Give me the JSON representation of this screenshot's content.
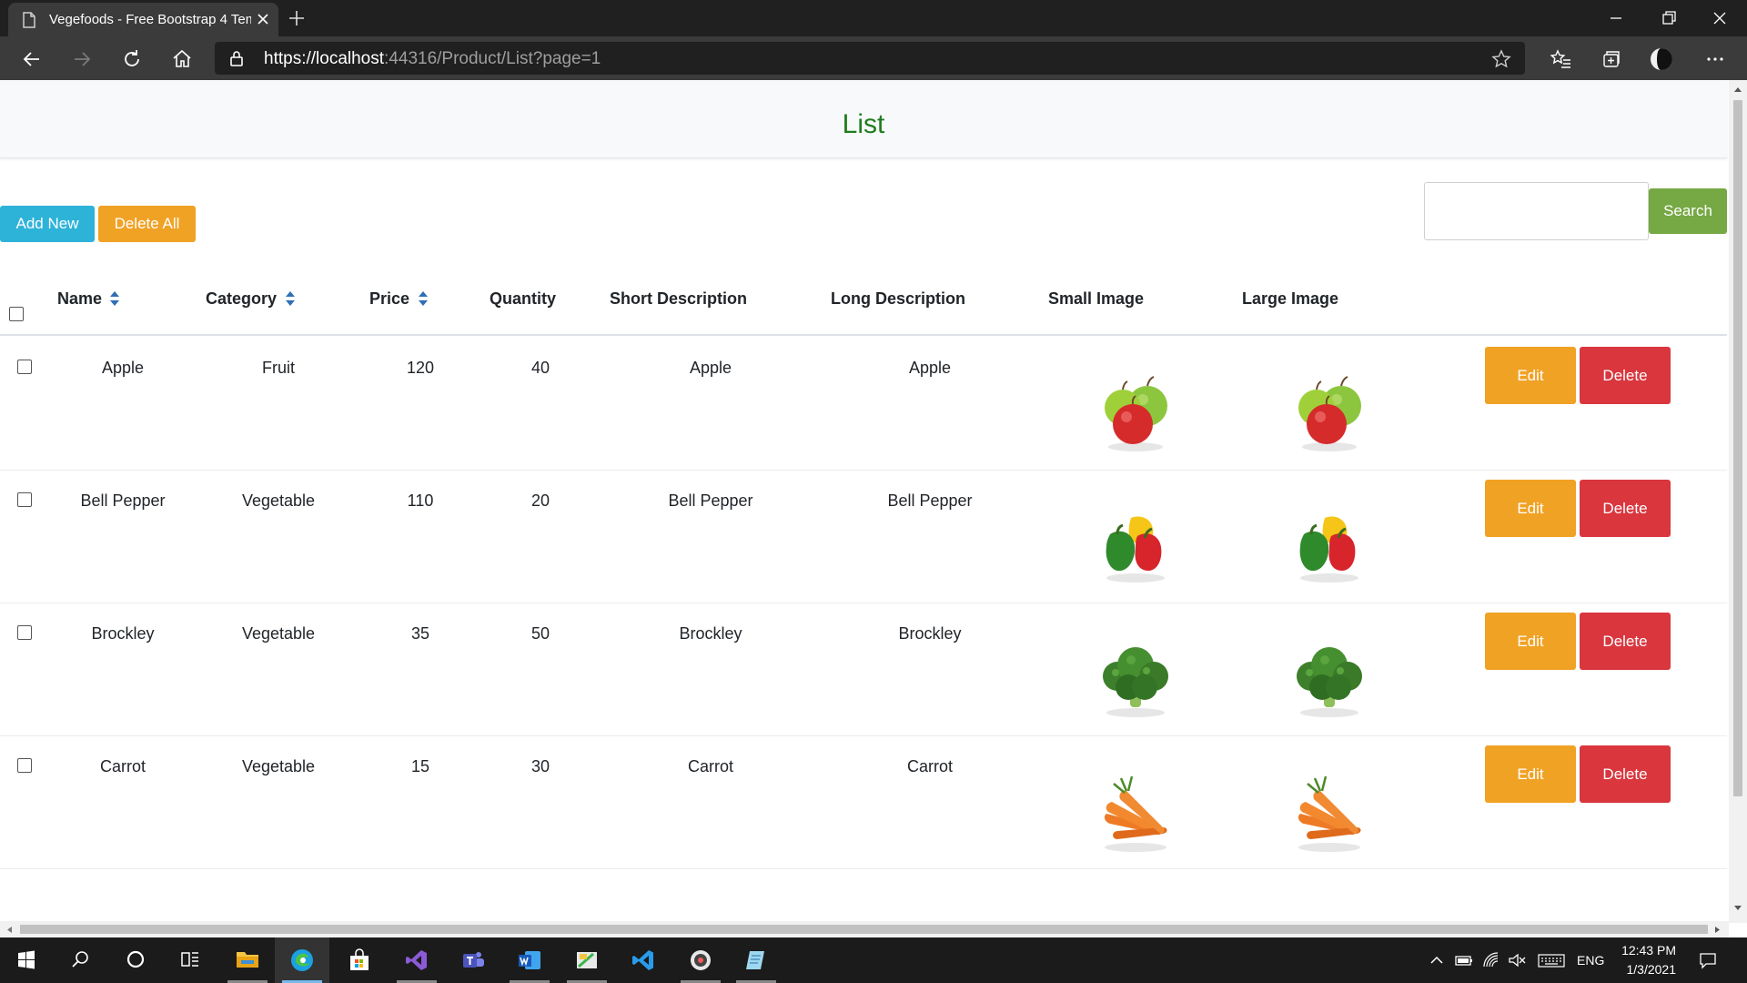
{
  "browser": {
    "tab_title": "Vegefoods - Free Bootstrap 4 Template",
    "url_main": "https://localhost",
    "url_rest": ":44316/Product/List?page=1"
  },
  "page": {
    "title": "List",
    "add_new_label": "Add New",
    "delete_all_label": "Delete All",
    "search_label": "Search",
    "search_value": ""
  },
  "table": {
    "headers": {
      "name": "Name",
      "category": "Category",
      "price": "Price",
      "quantity": "Quantity",
      "short_description": "Short Description",
      "long_description": "Long Description",
      "small_image": "Small Image",
      "large_image": "Large Image"
    },
    "edit_label": "Edit",
    "delete_label": "Delete",
    "rows": [
      {
        "name": "Apple",
        "category": "Fruit",
        "price": "120",
        "quantity": "40",
        "short_description": "Apple",
        "long_description": "Apple",
        "image": "apple"
      },
      {
        "name": "Bell Pepper",
        "category": "Vegetable",
        "price": "110",
        "quantity": "20",
        "short_description": "Bell Pepper",
        "long_description": "Bell Pepper",
        "image": "bell-pepper"
      },
      {
        "name": "Brockley",
        "category": "Vegetable",
        "price": "35",
        "quantity": "50",
        "short_description": "Brockley",
        "long_description": "Brockley",
        "image": "broccoli"
      },
      {
        "name": "Carrot",
        "category": "Vegetable",
        "price": "15",
        "quantity": "30",
        "short_description": "Carrot",
        "long_description": "Carrot",
        "image": "carrot"
      }
    ]
  },
  "taskbar": {
    "language": "ENG",
    "time": "12:43 PM",
    "date": "1/3/2021"
  },
  "colors": {
    "title_green": "#1e7d1e",
    "add_new": "#2eb3d8",
    "delete_all": "#f0a225",
    "search": "#76a844",
    "edit": "#f0a225",
    "delete": "#d9363e"
  }
}
